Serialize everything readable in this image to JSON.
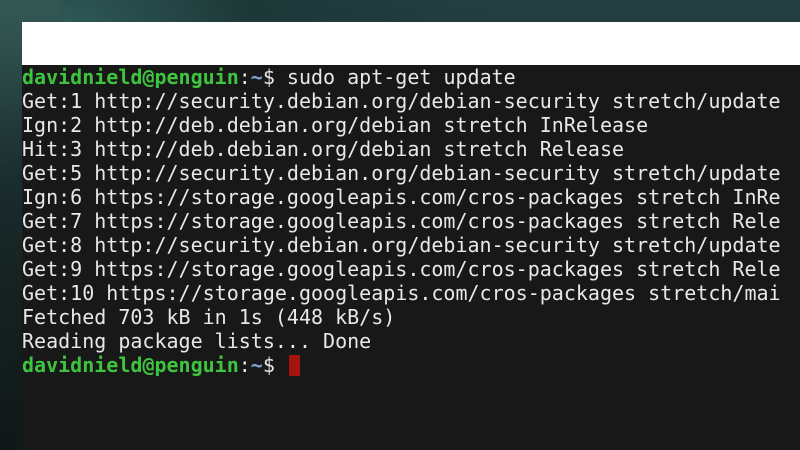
{
  "prompt": {
    "user_host": "davidnield@penguin",
    "separator": ":",
    "path": "~",
    "symbol": "$"
  },
  "command": " sudo apt-get update",
  "output_lines": [
    "Get:1 http://security.debian.org/debian-security stretch/update",
    "Ign:2 http://deb.debian.org/debian stretch InRelease",
    "Hit:3 http://deb.debian.org/debian stretch Release",
    "Get:5 http://security.debian.org/debian-security stretch/update",
    "Ign:6 https://storage.googleapis.com/cros-packages stretch InRe",
    "Get:7 https://storage.googleapis.com/cros-packages stretch Rele",
    "Get:8 http://security.debian.org/debian-security stretch/update",
    "Get:9 https://storage.googleapis.com/cros-packages stretch Rele",
    "Get:10 https://storage.googleapis.com/cros-packages stretch/mai",
    "Fetched 703 kB in 1s (448 kB/s)",
    "Reading package lists... Done"
  ],
  "colors": {
    "terminal_bg": "#181818",
    "user_green": "#3ec43e",
    "path_blue": "#7fa7d6",
    "text": "#e8e8e8",
    "cursor": "#a3140f",
    "titlebar": "#ffffff"
  }
}
